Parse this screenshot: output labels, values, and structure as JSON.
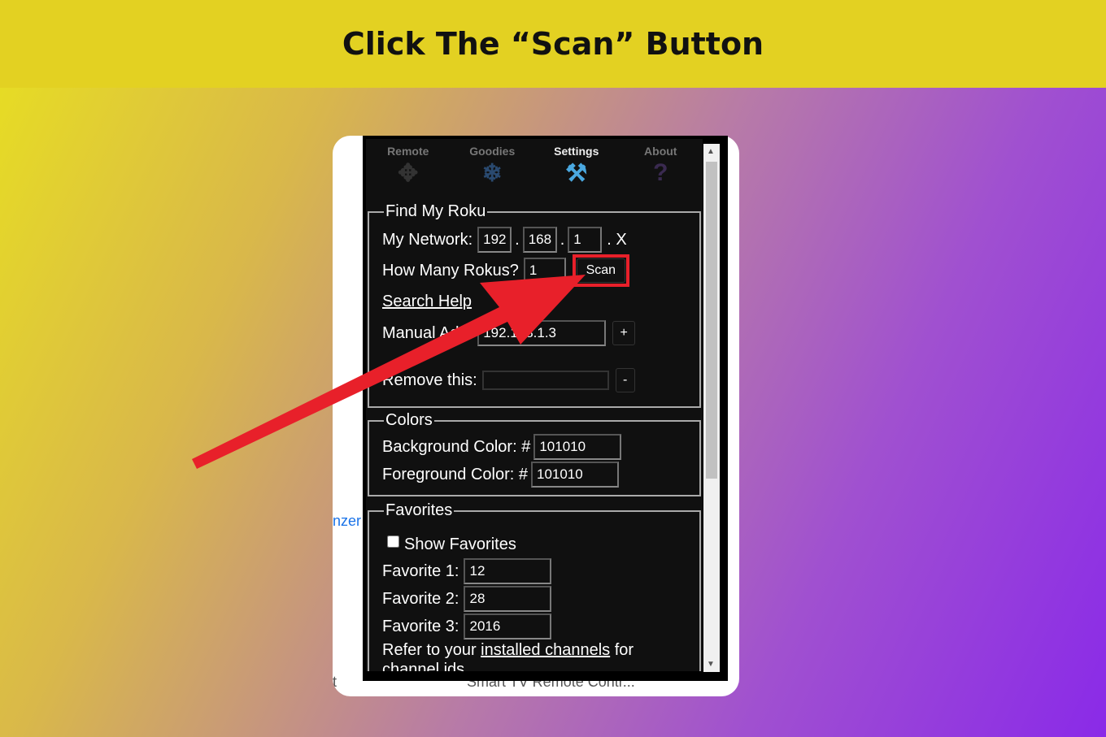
{
  "banner": {
    "title": "Click The “Scan” Button"
  },
  "background_page": {
    "left_text_1": "nzer",
    "left_text_2": "t",
    "bottom_text": "Smart TV Remote Contr..."
  },
  "tabs": [
    {
      "label": "Remote",
      "icon": "dpad-icon"
    },
    {
      "label": "Goodies",
      "icon": "snowflake-icon"
    },
    {
      "label": "Settings",
      "icon": "tools-icon",
      "active": true
    },
    {
      "label": "About",
      "icon": "question-icon"
    }
  ],
  "find": {
    "legend": "Find My Roku",
    "network_label": "My Network:",
    "octet1": "192",
    "octet2": "168",
    "octet3": "1",
    "dot": ".",
    "x_label": ". X",
    "count_label": "How Many Rokus?",
    "count_value": "1",
    "scan_label": "Scan",
    "search_help": "Search Help",
    "manual_label": "Manual Add:",
    "manual_value": "192.168.1.3",
    "add_label": "+",
    "remove_label": "Remove this:",
    "remove_value": "",
    "remove_btn": "-"
  },
  "colors": {
    "legend": "Colors",
    "bg_label": "Background Color: #",
    "bg_value": "101010",
    "fg_label": "Foreground Color: #",
    "fg_value": "101010"
  },
  "favorites": {
    "legend": "Favorites",
    "show_label": "Show Favorites",
    "show_checked": false,
    "items": [
      {
        "label": "Favorite 1:",
        "value": "12"
      },
      {
        "label": "Favorite 2:",
        "value": "28"
      },
      {
        "label": "Favorite 3:",
        "value": "2016"
      }
    ],
    "refer_pre": "Refer to your ",
    "refer_link": "installed channels",
    "refer_post": " for",
    "refer_line2": "channel ids."
  },
  "highlight_color": "#e8202a"
}
